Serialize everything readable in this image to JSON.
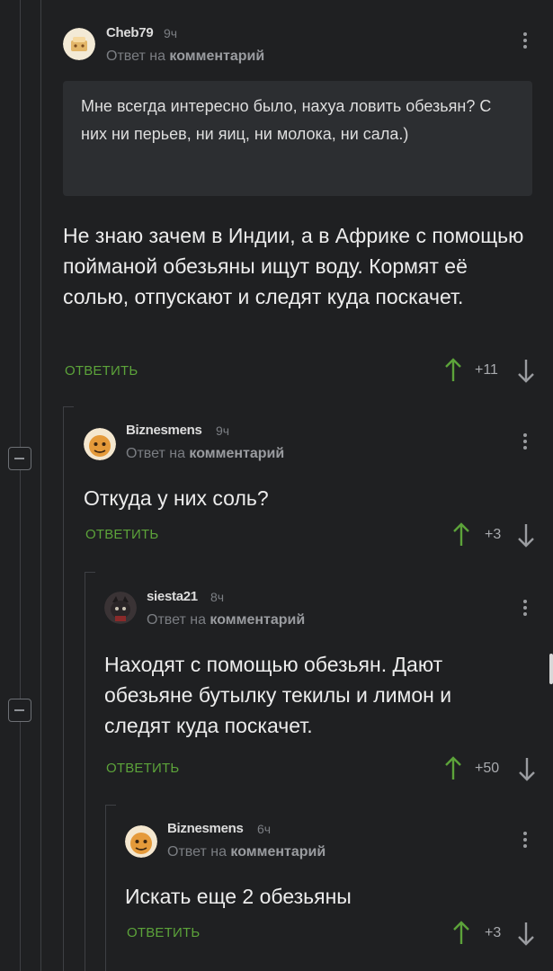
{
  "thread": {
    "comments": [
      {
        "username": "Cheb79",
        "time": "9ч",
        "reply_prefix": "Ответ на",
        "reply_target": "комментарий",
        "quote": "Мне всегда интересно было, нахуа ловить обезьян? С них ни перьев, ни яиц, ни молока, ни сала.)",
        "text": "Не знаю зачем в Индии, а в Африке с помощью пойманой обезьяны ищут воду. Кормят её солью, отпускают и следят куда поскачет.",
        "reply_label": "ОТВЕТИТЬ",
        "score": "+11"
      },
      {
        "username": "Biznesmens",
        "time": "9ч",
        "reply_prefix": "Ответ на",
        "reply_target": "комментарий",
        "text": "Откуда у них соль?",
        "reply_label": "ОТВЕТИТЬ",
        "score": "+3"
      },
      {
        "username": "siesta21",
        "time": "8ч",
        "reply_prefix": "Ответ на",
        "reply_target": "комментарий",
        "text": "Находят с помощью обезьян. Дают обезьяне бутылку текилы и лимон и следят куда поскачет.",
        "reply_label": "ОТВЕТИТЬ",
        "score": "+50"
      },
      {
        "username": "Biznesmens",
        "time": "6ч",
        "reply_prefix": "Ответ на",
        "reply_target": "комментарий",
        "text": "Искать еще 2 обезьяны",
        "reply_label": "ОТВЕТИТЬ",
        "score": "+3"
      }
    ]
  },
  "icons": {
    "upvote": "arrow-up-icon",
    "downvote": "arrow-down-icon",
    "menu": "kebab-menu-icon",
    "collapse": "collapse-icon"
  },
  "colors": {
    "background": "#1f2022",
    "accent_green": "#5ca33a",
    "quote_bg": "#2c2e31",
    "muted": "#7b7e83"
  }
}
